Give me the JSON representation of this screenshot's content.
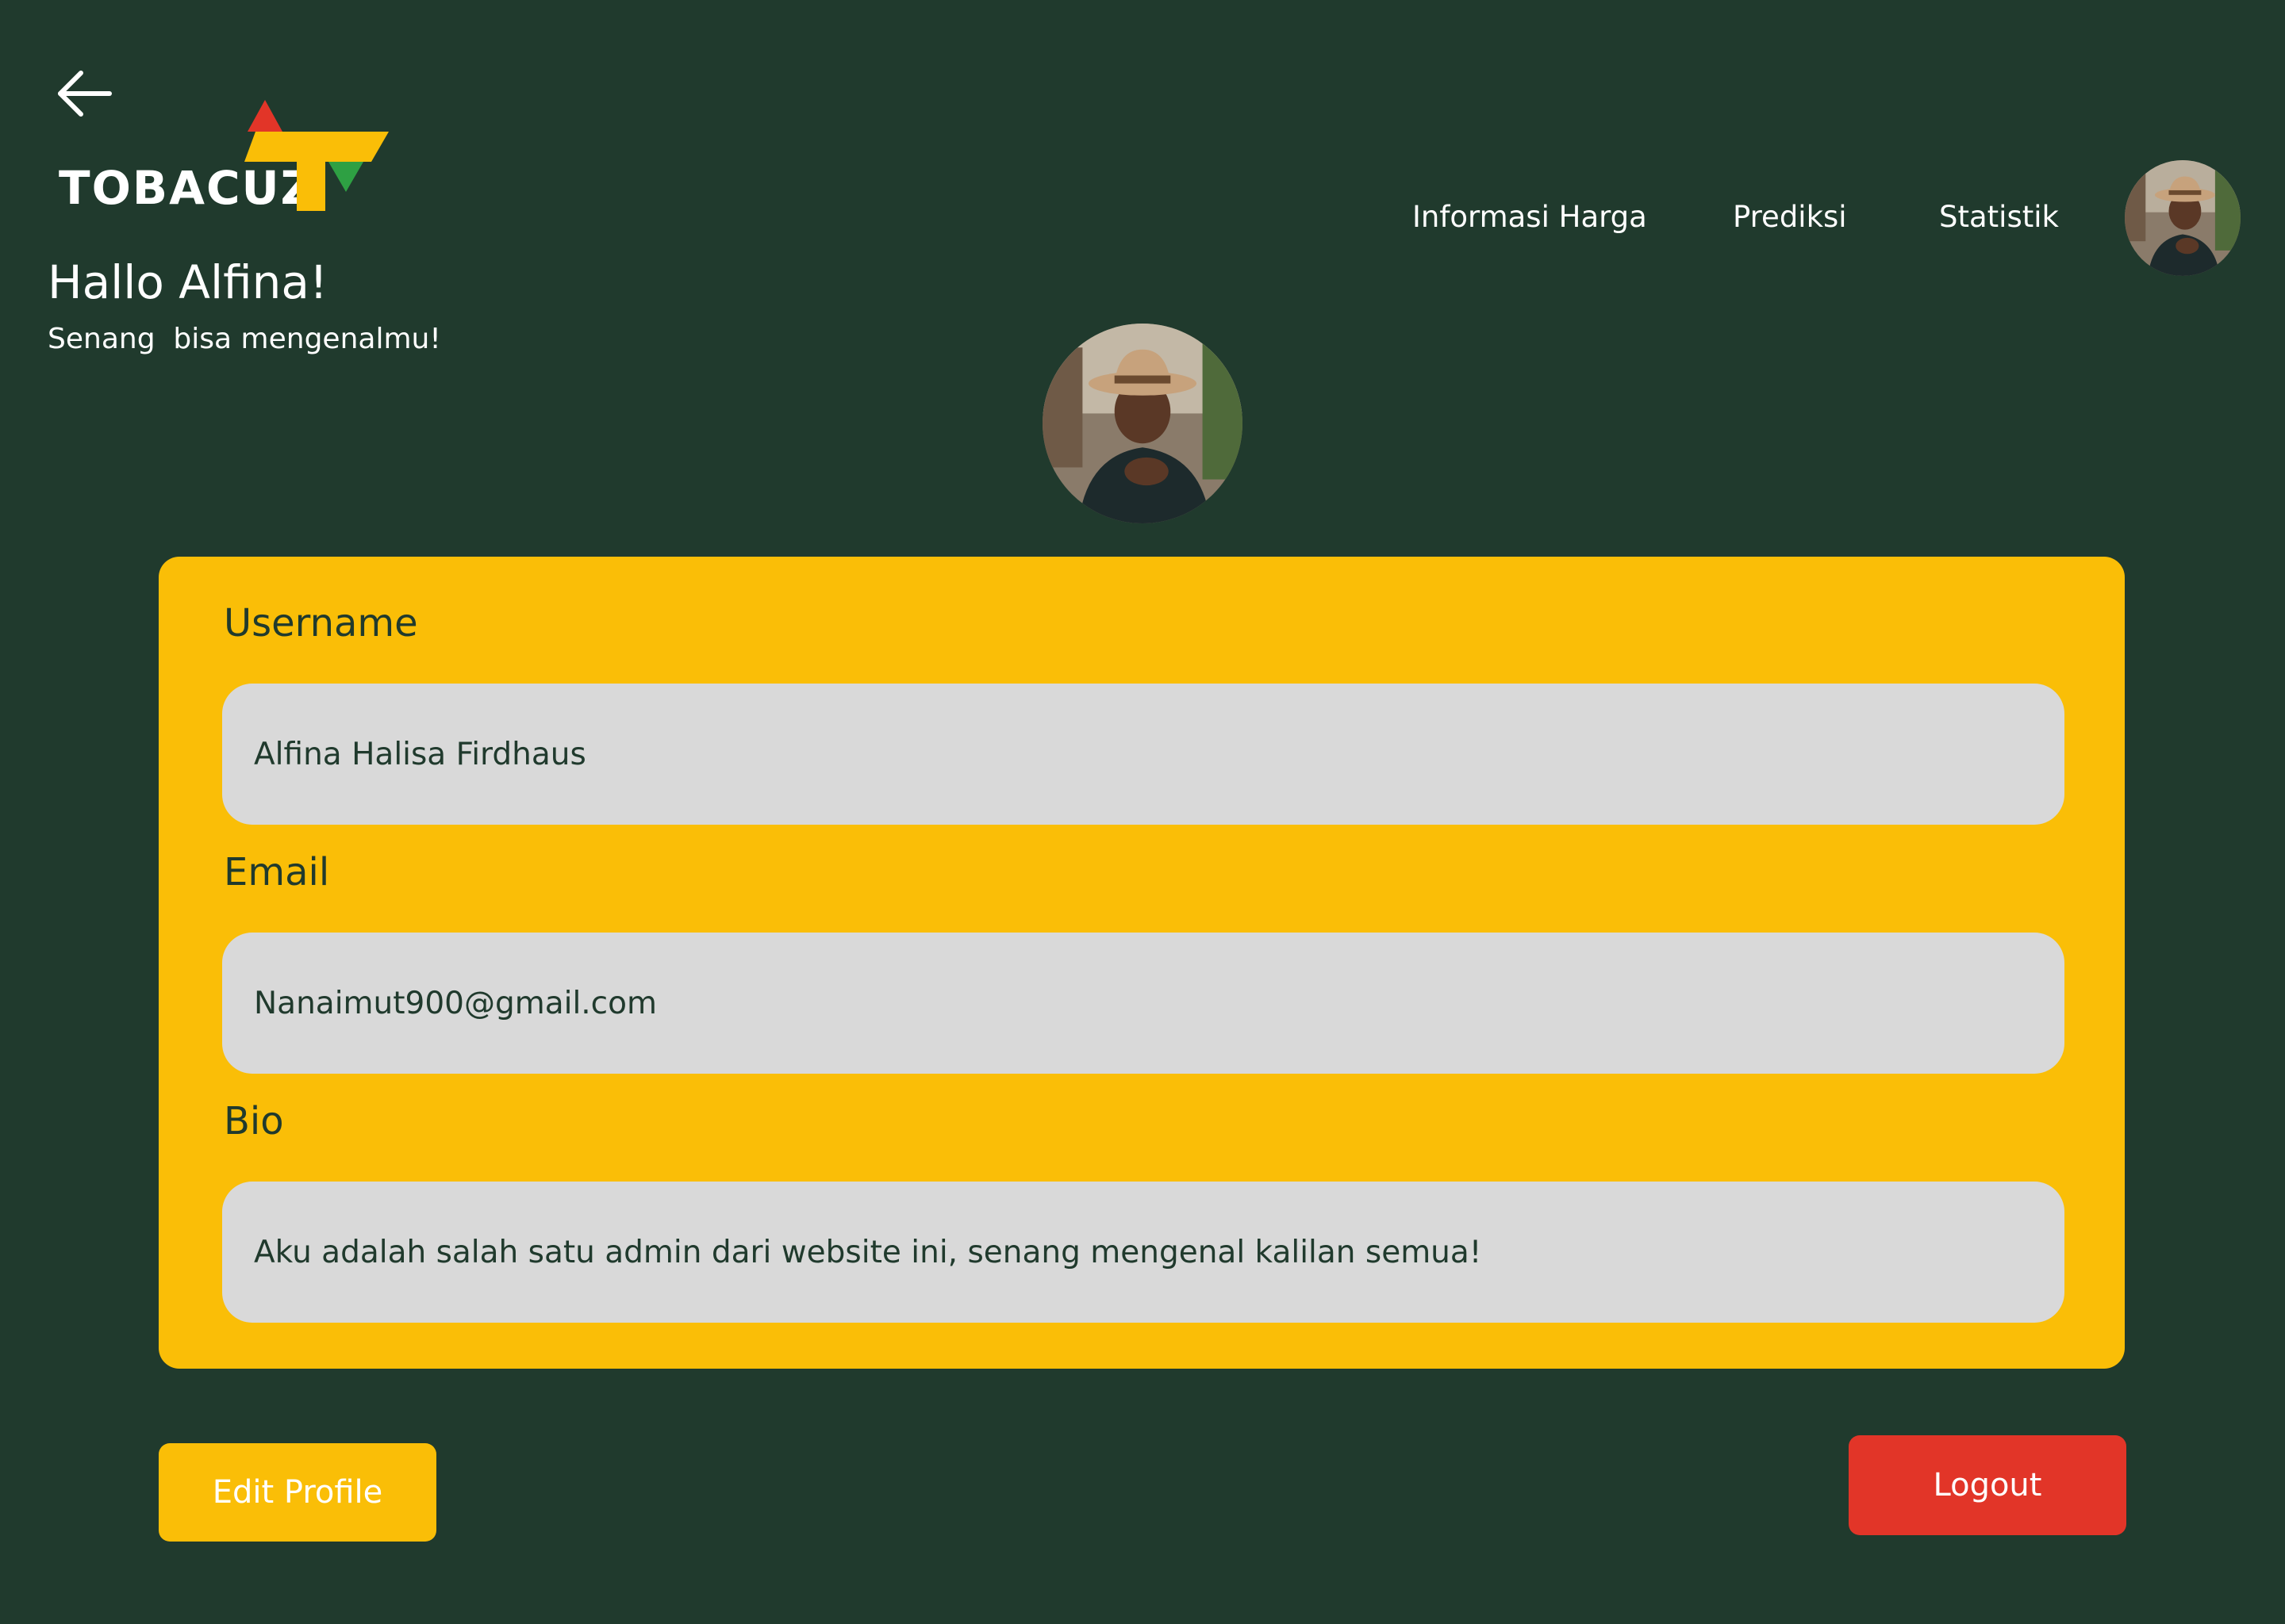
{
  "header": {
    "logo_text": "TOBACUZ",
    "greeting_title": "Hallo Alfina!",
    "greeting_subtitle": "Senang  bisa mengenalmu!"
  },
  "nav": {
    "items": [
      {
        "label": "Informasi Harga"
      },
      {
        "label": "Prediksi"
      },
      {
        "label": "Statistik"
      }
    ]
  },
  "profile": {
    "fields": [
      {
        "label": "Username",
        "value": "Alfina Halisa Firdhaus"
      },
      {
        "label": "Email",
        "value": "Nanaimut900@gmail.com"
      },
      {
        "label": "Bio",
        "value": "Aku adalah salah satu admin dari website ini, senang mengenal kalilan semua!"
      }
    ]
  },
  "actions": {
    "edit_label": "Edit Profile",
    "logout_label": "Logout"
  },
  "icons": {
    "back": "arrow-left-icon",
    "avatar": "user-avatar"
  },
  "colors": {
    "background": "#203a2d",
    "card": "#fabe07",
    "input": "#d9d9d9",
    "text_dark": "#203a2d",
    "logout": "#e23528",
    "logo_red": "#e23528",
    "logo_yellow": "#fabe07",
    "logo_green": "#2ea043"
  }
}
